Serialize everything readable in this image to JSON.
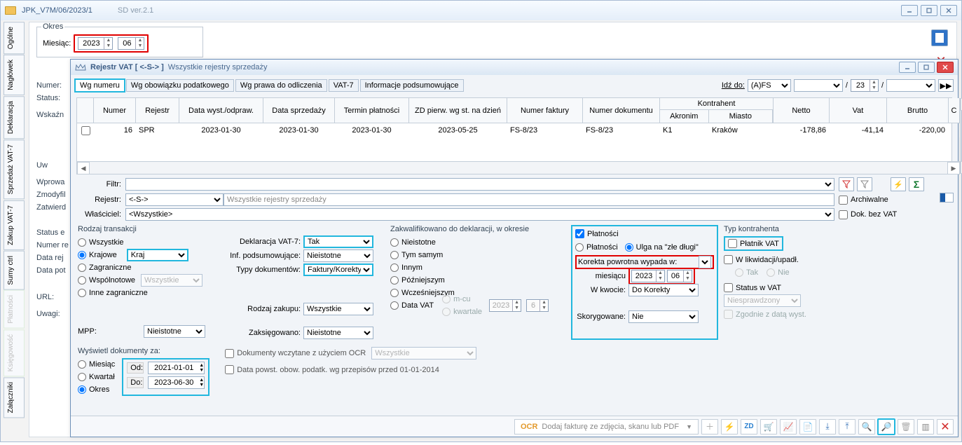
{
  "back": {
    "title": "JPK_V7M/06/2023/1",
    "version": "SD ver.2.1",
    "okres_label": "Okres",
    "miesiac_label": "Miesiąc:",
    "year": "2023",
    "month": "06",
    "rows": [
      "Numer:",
      "Status:",
      "Wskaźn",
      "Uw",
      "Wprowa",
      "Zmodyfil",
      "Zatwierd",
      "Status e",
      "Numer re",
      "Data rej",
      "Data pot",
      "URL:",
      "Uwagi:"
    ],
    "side_tabs": [
      "Ogólne",
      "Nagłówek",
      "Deklaracja",
      "Sprzedaż VAT-7",
      "Zakup VAT-7",
      "Sumy ctrl",
      "Płatności",
      "Księgowość",
      "Załączniki"
    ]
  },
  "front": {
    "title_bold": "Rejestr VAT  [ <-S-> ]",
    "title_rest": "Wszystkie rejestry sprzedaży",
    "tabs": [
      "Wg numeru",
      "Wg obowiązku podatkowego",
      "Wg prawa do odliczenia",
      "VAT-7",
      "Informacje podsumowujące"
    ],
    "idz_label": "Idź do:",
    "idz_sel": "(A)FS",
    "idz_div": "/",
    "idz_num": "23",
    "grid": {
      "headers": [
        "Numer",
        "Rejestr",
        "Data wyst./odpraw.",
        "Data sprzedaży",
        "Termin płatności",
        "ZD pierw. wg st. na dzień",
        "Numer faktury",
        "Numer dokumentu"
      ],
      "kontr_top": "Kontrahent",
      "kontr_sub": [
        "Akronim",
        "Miasto"
      ],
      "amount_heads": [
        "Netto",
        "Vat",
        "Brutto"
      ],
      "row": [
        "16",
        "SPR",
        "2023-01-30",
        "2023-01-30",
        "2023-01-30",
        "2023-05-25",
        "FS-8/23",
        "FS-8/23",
        "K1",
        "Kraków",
        "-178,86",
        "-41,14",
        "-220,00"
      ]
    },
    "filters": {
      "filtr_label": "Filtr:",
      "rejestr_label": "Rejestr:",
      "rejestr_val": "<-S->",
      "rejestr_desc": "Wszystkie rejestry sprzedaży",
      "wl_label": "Właściciel:",
      "wl_val": "<Wszystkie>",
      "arch": "Archiwalne",
      "dok": "Dok. bez VAT"
    },
    "rodzaj": {
      "title": "Rodzaj transakcji",
      "opts": [
        "Wszystkie",
        "Krajowe",
        "Zagraniczne",
        "Wspólnotowe",
        "Inne zagraniczne"
      ],
      "kraj_val": "Kraj",
      "wspol_val": "Wszystkie",
      "mpp_label": "MPP:",
      "mpp_val": "Nieistotne"
    },
    "mid": {
      "dekl_label": "Deklaracja VAT-7:",
      "dekl_val": "Tak",
      "infp_label": "Inf. podsumowujące:",
      "infp_val": "Nieistotne",
      "typd_label": "Typy dokumentów:",
      "typd_val": "Faktury/Korekty",
      "rz_label": "Rodzaj zakupu:",
      "rz_val": "Wszystkie",
      "zaks_label": "Zaksięgowano:",
      "zaks_val": "Nieistotne"
    },
    "zakw": {
      "title": "Zakwalifikowano do deklaracji, w okresie",
      "opts": [
        "Nieistotne",
        "Tym samym",
        "Innym",
        "Późniejszym",
        "Wcześniejszym",
        "Data VAT"
      ],
      "mcu": "m-cu",
      "kwa": "kwartale",
      "year": "2023",
      "month": "6"
    },
    "plat": {
      "chk_plat": "Płatności",
      "opt_plat": "Płatności",
      "opt_ulga": "Ulga na \"złe długi\"",
      "korekta_label": "Korekta powrotna wypada w:",
      "mies_label": "miesiącu",
      "year": "2023",
      "month": "06",
      "wkw_label": "W kwocie:",
      "wkw_val": "Do Korekty",
      "skor_label": "Skorygowane:",
      "skor_val": "Nie"
    },
    "typk": {
      "title": "Typ kontrahenta",
      "platnik": "Płatnik VAT",
      "likw": "W likwidacji/upadł.",
      "tak": "Tak",
      "nie": "Nie",
      "status": "Status w VAT",
      "status_val": "Niesprawdzony",
      "zgod": "Zgodnie z datą wyst."
    },
    "display": {
      "title": "Wyświetl dokumenty za:",
      "opts": [
        "Miesiąc",
        "Kwartał",
        "Okres"
      ],
      "od": "Od:",
      "do": "Do:",
      "od_val": "2021-01-01",
      "do_val": "2023-06-30"
    },
    "checks": {
      "ocr_label": "Dokumenty wczytane z użyciem OCR",
      "ocr_val": "Wszystkie",
      "oldp": "Data powst. obow. podatk. wg przepisów przed 01-01-2014"
    },
    "toolbar": {
      "ocr_btn": "Dodaj fakturę ze zdjęcia, skanu lub PDF",
      "items": [
        "plus-icon",
        "bolt-icon",
        "zd-icon",
        "cart-icon",
        "chart-icon",
        "copy-icon",
        "import-icon",
        "export-icon",
        "search-icon",
        "filter-icon",
        "trash-icon",
        "columns-icon",
        "close-icon"
      ]
    }
  }
}
